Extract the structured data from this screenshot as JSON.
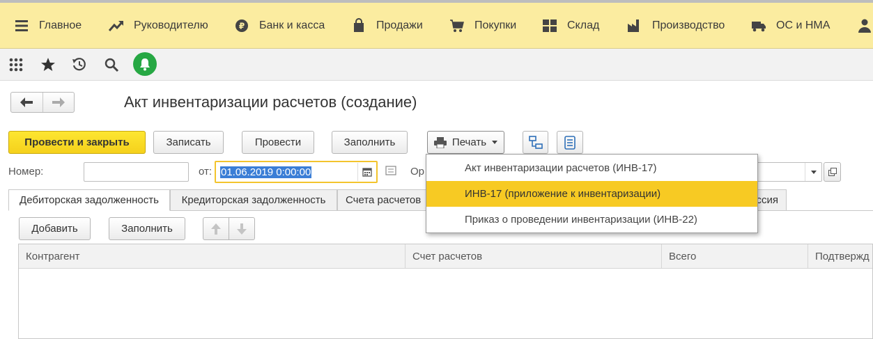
{
  "sections": [
    {
      "label": "Главное",
      "icon": "menu-icon"
    },
    {
      "label": "Руководителю",
      "icon": "trend-icon"
    },
    {
      "label": "Банк и касса",
      "icon": "ruble-icon"
    },
    {
      "label": "Продажи",
      "icon": "bag-icon"
    },
    {
      "label": "Покупки",
      "icon": "cart-icon"
    },
    {
      "label": "Склад",
      "icon": "warehouse-icon"
    },
    {
      "label": "Производство",
      "icon": "factory-icon"
    },
    {
      "label": "ОС и НМА",
      "icon": "truck-icon"
    },
    {
      "label": "",
      "icon": "person-icon"
    }
  ],
  "toolbar": {
    "icons": [
      "apps-grid-icon",
      "favorites-star-icon",
      "history-icon",
      "search-icon",
      "notifications-bell-icon"
    ],
    "bell_color": "#27a844"
  },
  "document": {
    "title": "Акт инвентаризации расчетов (создание)"
  },
  "commands": {
    "post_and_close": "Провести и закрыть",
    "save": "Записать",
    "post": "Провести",
    "fill": "Заполнить",
    "print": "Печать",
    "accent_color": "#f5d11c"
  },
  "form": {
    "number_label": "Номер:",
    "number_value": "",
    "date_label": "от:",
    "date_value": "01.06.2019  0:00:00",
    "org_label_partial": "Ор"
  },
  "tabs": [
    {
      "label": "Дебиторская задолженность",
      "active": true
    },
    {
      "label": "Кредиторская задолженность",
      "active": false
    },
    {
      "label": "Счета расчетов",
      "active": false
    },
    {
      "label": "ссия",
      "active": false
    }
  ],
  "table_toolbar": {
    "add": "Добавить",
    "fill": "Заполнить"
  },
  "table": {
    "columns": [
      "Контрагент",
      "Счет расчетов",
      "Всего",
      "Подтвержд"
    ],
    "rows": []
  },
  "print_menu": {
    "items": [
      {
        "label": "Акт инвентаризации расчетов (ИНВ-17)",
        "highlighted": false
      },
      {
        "label": "ИНВ-17 (приложение к инвентаризации)",
        "highlighted": true
      },
      {
        "label": "Приказ о проведении инвентаризации (ИНВ-22)",
        "highlighted": false
      }
    ],
    "highlight_color": "#f7ca23"
  }
}
